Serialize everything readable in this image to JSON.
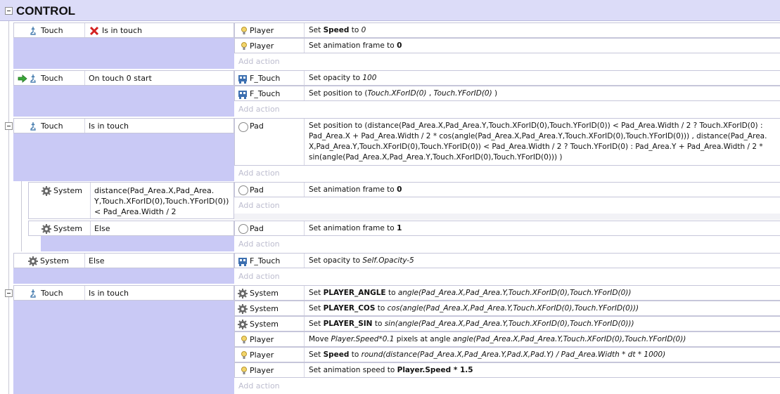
{
  "group": {
    "title": "CONTROL"
  },
  "add_action_label": "Add action",
  "events": [
    {
      "condition": {
        "object": "Touch",
        "text": "Is in touch",
        "inverted_icon": "red-x-icon"
      },
      "actions": [
        {
          "object": "Player",
          "parts": [
            "Set ",
            "Speed",
            " to ",
            "0"
          ]
        },
        {
          "object": "Player",
          "parts": [
            "Set animation frame to ",
            "0"
          ]
        }
      ]
    },
    {
      "condition": {
        "object": "Touch",
        "text": "On touch 0 start",
        "trigger_icon": "green-arrow-icon"
      },
      "actions": [
        {
          "object": "F_Touch",
          "parts": [
            "Set opacity to ",
            "100"
          ]
        },
        {
          "object": "F_Touch",
          "parts": [
            "Set position to (",
            "Touch.XForID(0)",
            " , ",
            "Touch.YForID(0)",
            " )"
          ]
        }
      ]
    },
    {
      "condition": {
        "object": "Touch",
        "text": "Is in touch"
      },
      "actions": [
        {
          "object": "Pad",
          "lines": [
            "Set position to (distance(Pad_Area.X,Pad_Area.Y,Touch.XForID(0),Touch.YForID(0)) < Pad_Area.Width / 2 ? Touch.XForID(0) :",
            "Pad_Area.X + Pad_Area.Width / 2 * cos(angle(Pad_Area.X,Pad_Area.Y,Touch.XForID(0),Touch.YForID(0)))        , distance(Pad_Area.",
            "X,Pad_Area.Y,Touch.XForID(0),Touch.YForID(0)) < Pad_Area.Width / 2 ? Touch.YForID(0) : Pad_Area.Y + Pad_Area.Width / 2 *",
            "sin(angle(Pad_Area.X,Pad_Area.Y,Touch.XForID(0),Touch.YForID(0)))     )"
          ]
        }
      ]
    },
    {
      "sub": true,
      "condition": {
        "object": "System",
        "lines": [
          "distance(Pad_Area.X,Pad_Area.",
          "Y,Touch.XForID(0),Touch.YForID(0))",
          "< Pad_Area.Width / 2"
        ]
      },
      "actions": [
        {
          "object": "Pad",
          "parts": [
            "Set animation frame to ",
            "0"
          ]
        }
      ]
    },
    {
      "sub": true,
      "condition": {
        "object": "System",
        "text": "Else"
      },
      "actions": [
        {
          "object": "Pad",
          "parts": [
            "Set animation frame to ",
            "1"
          ]
        }
      ]
    },
    {
      "condition": {
        "object": "System",
        "text": "Else"
      },
      "actions": [
        {
          "object": "F_Touch",
          "parts": [
            "Set opacity to ",
            "Self.Opacity-5"
          ]
        }
      ]
    },
    {
      "condition": {
        "object": "Touch",
        "text": "Is in touch"
      },
      "actions": [
        {
          "object": "System",
          "parts": [
            "Set ",
            "PLAYER_ANGLE",
            " to ",
            "angle(Pad_Area.X,Pad_Area.Y,Touch.XForID(0),Touch.YForID(0))"
          ]
        },
        {
          "object": "System",
          "parts": [
            "Set ",
            "PLAYER_COS",
            " to ",
            "cos(angle(Pad_Area.X,Pad_Area.Y,Touch.XForID(0),Touch.YForID(0)))"
          ]
        },
        {
          "object": "System",
          "parts": [
            "Set ",
            "PLAYER_SIN",
            " to ",
            "sin(angle(Pad_Area.X,Pad_Area.Y,Touch.XForID(0),Touch.YForID(0)))"
          ]
        },
        {
          "object": "Player",
          "parts": [
            "Move ",
            "Player.Speed*0.1",
            "  pixels at angle ",
            "angle(Pad_Area.X,Pad_Area.Y,Touch.XForID(0),Touch.YForID(0))"
          ]
        },
        {
          "object": "Player",
          "parts": [
            "Set ",
            "Speed",
            " to ",
            "round(distance(Pad_Area.X,Pad_Area.Y,Pad.X,Pad.Y) / Pad_Area.Width * dt * 1000)"
          ]
        },
        {
          "object": "Player",
          "parts": [
            "Set animation speed to ",
            "Player.Speed * 1.5"
          ]
        }
      ]
    }
  ],
  "colors": {
    "lane": "#c9c9f5",
    "header": "#dcdcf8",
    "add_action": "#bdbdcf"
  }
}
